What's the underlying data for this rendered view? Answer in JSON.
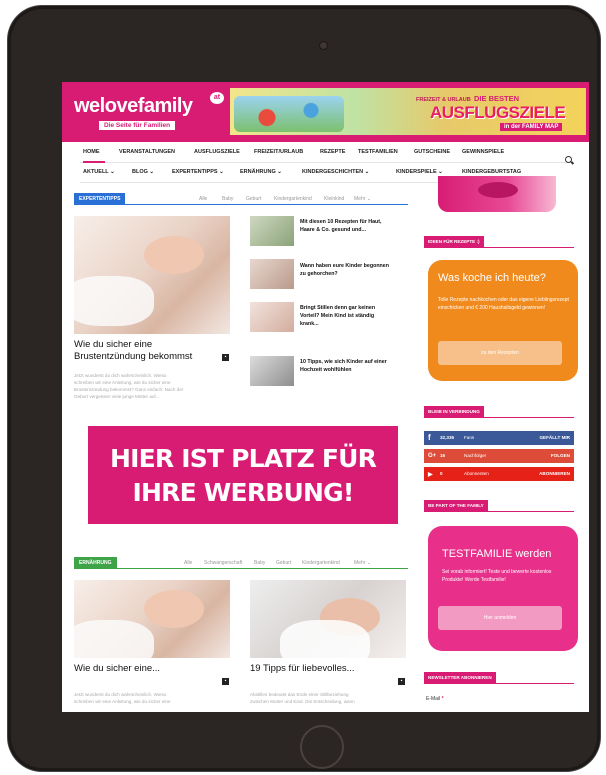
{
  "header": {
    "logo_text": "welovefamily",
    "logo_heart": "at",
    "logo_tagline": "Die Seite für Familien",
    "banner": {
      "small": "FREIZEIT & URLAUB",
      "top": "DIE BESTEN",
      "big": "AUSFLUGSZIELE",
      "sub": "in der FAMILY MAP"
    }
  },
  "nav_primary": [
    "HOME",
    "VERANSTALTUNGEN",
    "AUSFLUGSZIELE",
    "FREIZEIT/URLAUB",
    "REZEPTE",
    "TESTFAMILIEN",
    "GUTSCHEINE",
    "GEWINNSPIELE"
  ],
  "nav_secondary": [
    "AKTUELL ⌄",
    "BLOG ⌄",
    "EXPERTENTIPPS ⌄",
    "ERNÄHRUNG ⌄",
    "KINDERGESCHICHTEN ⌄",
    "KINDERSPIELE ⌄",
    "KINDERGEBURTSTAG"
  ],
  "block1": {
    "tag": "EXPERTENTIPPS",
    "filters": [
      "Alle",
      "Baby",
      "Geburt",
      "Kindergartenkind",
      "Kleinkind",
      "Mehr ⌄"
    ],
    "main": {
      "title_line1": "Wie du sicher eine",
      "title_line2": "Brustentzündung bekommst",
      "excerpt_lines": [
        "Jetzt wunderst du dich wahrscheinlich. Wieso",
        "schreiben wir eine Anleitung, wie du sicher eine",
        "Brustentzündung bekommst? Ganz einfach: Nach der",
        "Geburt vergessen viele junge Mütter auf..."
      ]
    },
    "list": [
      {
        "line1": "Mit diesen 10 Rezepten für Haut,",
        "line2": "Haare & Co. gesund und..."
      },
      {
        "line1": "Wann haben eure Kinder begonnen",
        "line2": "zu gehorchen?"
      },
      {
        "line1": "Bringt Stillen denn gar keinen",
        "line2": "Vorteil? Mein Kind ist ständig",
        "line3": "krank..."
      },
      {
        "line1": "10 Tipps, wie sich Kinder auf einer",
        "line2": "Hochzeit wohlfühlen"
      }
    ]
  },
  "ad": {
    "line1": "HIER IST PLATZ FÜR",
    "line2": "IHRE WERBUNG!"
  },
  "block2": {
    "tag": "ERNÄHRUNG",
    "filters": [
      "Alle",
      "Schwangerschaft",
      "Baby",
      "Geburt",
      "Kindergartenkind",
      "Mehr ⌄"
    ],
    "left": {
      "title": "Wie du sicher eine...",
      "excerpt_lines": [
        "Jetzt wunderst du dich wahrscheinlich. Wieso",
        "schreiben wir eine Anleitung, wie du sicher eine"
      ]
    },
    "right": {
      "title": "19 Tipps für liebevolles...",
      "excerpt_lines": [
        "Abstillen bedeutet das Ende einer Stillbeziehung",
        "zwischen Mutter und Kind. Die Entscheidung, wann"
      ]
    }
  },
  "sidebar": {
    "recipes_head": "IDEEN FÜR REZEPTE :)",
    "recipes_box": {
      "title": "Was koche ich heute?",
      "text": "Tolle Rezepte nachkochen oder das eigene Lieblingsrezept einschicken und € 200 Haushaltsgeld gewinnen!",
      "button": "zu den Rezepten"
    },
    "connected_head": "BLEIB IN VERBINDUNG",
    "social": [
      {
        "icon": "f",
        "count": "32,336",
        "label": "Fans",
        "action": "GEFÄLLT MIR",
        "color": "#3b5998"
      },
      {
        "icon": "G+",
        "count": "16",
        "label": "Nachfolger",
        "action": "FOLGEN",
        "color": "#dd4b39"
      },
      {
        "icon": "▶",
        "count": "0",
        "label": "Abonnenten",
        "action": "ABONNIEREN",
        "color": "#e62117"
      }
    ],
    "family_head": "BE PART OF THE FAMILY",
    "family_box": {
      "title": "TESTFAMILIE werden",
      "text": "Sei vorab informiert! Teste und bewerte kostenlos Produkte! Werde Testfamilie!",
      "button": "Hier anmelden"
    },
    "newsletter_head": "NEWSLETTER ABONNIEREN",
    "email_label": "E-Mail",
    "email_required": "*"
  },
  "colors": {
    "brand": "#d81c74",
    "expert_tag": "#2a6fd6",
    "nutrition_tag": "#3fa447",
    "orange": "#f08a1c"
  }
}
